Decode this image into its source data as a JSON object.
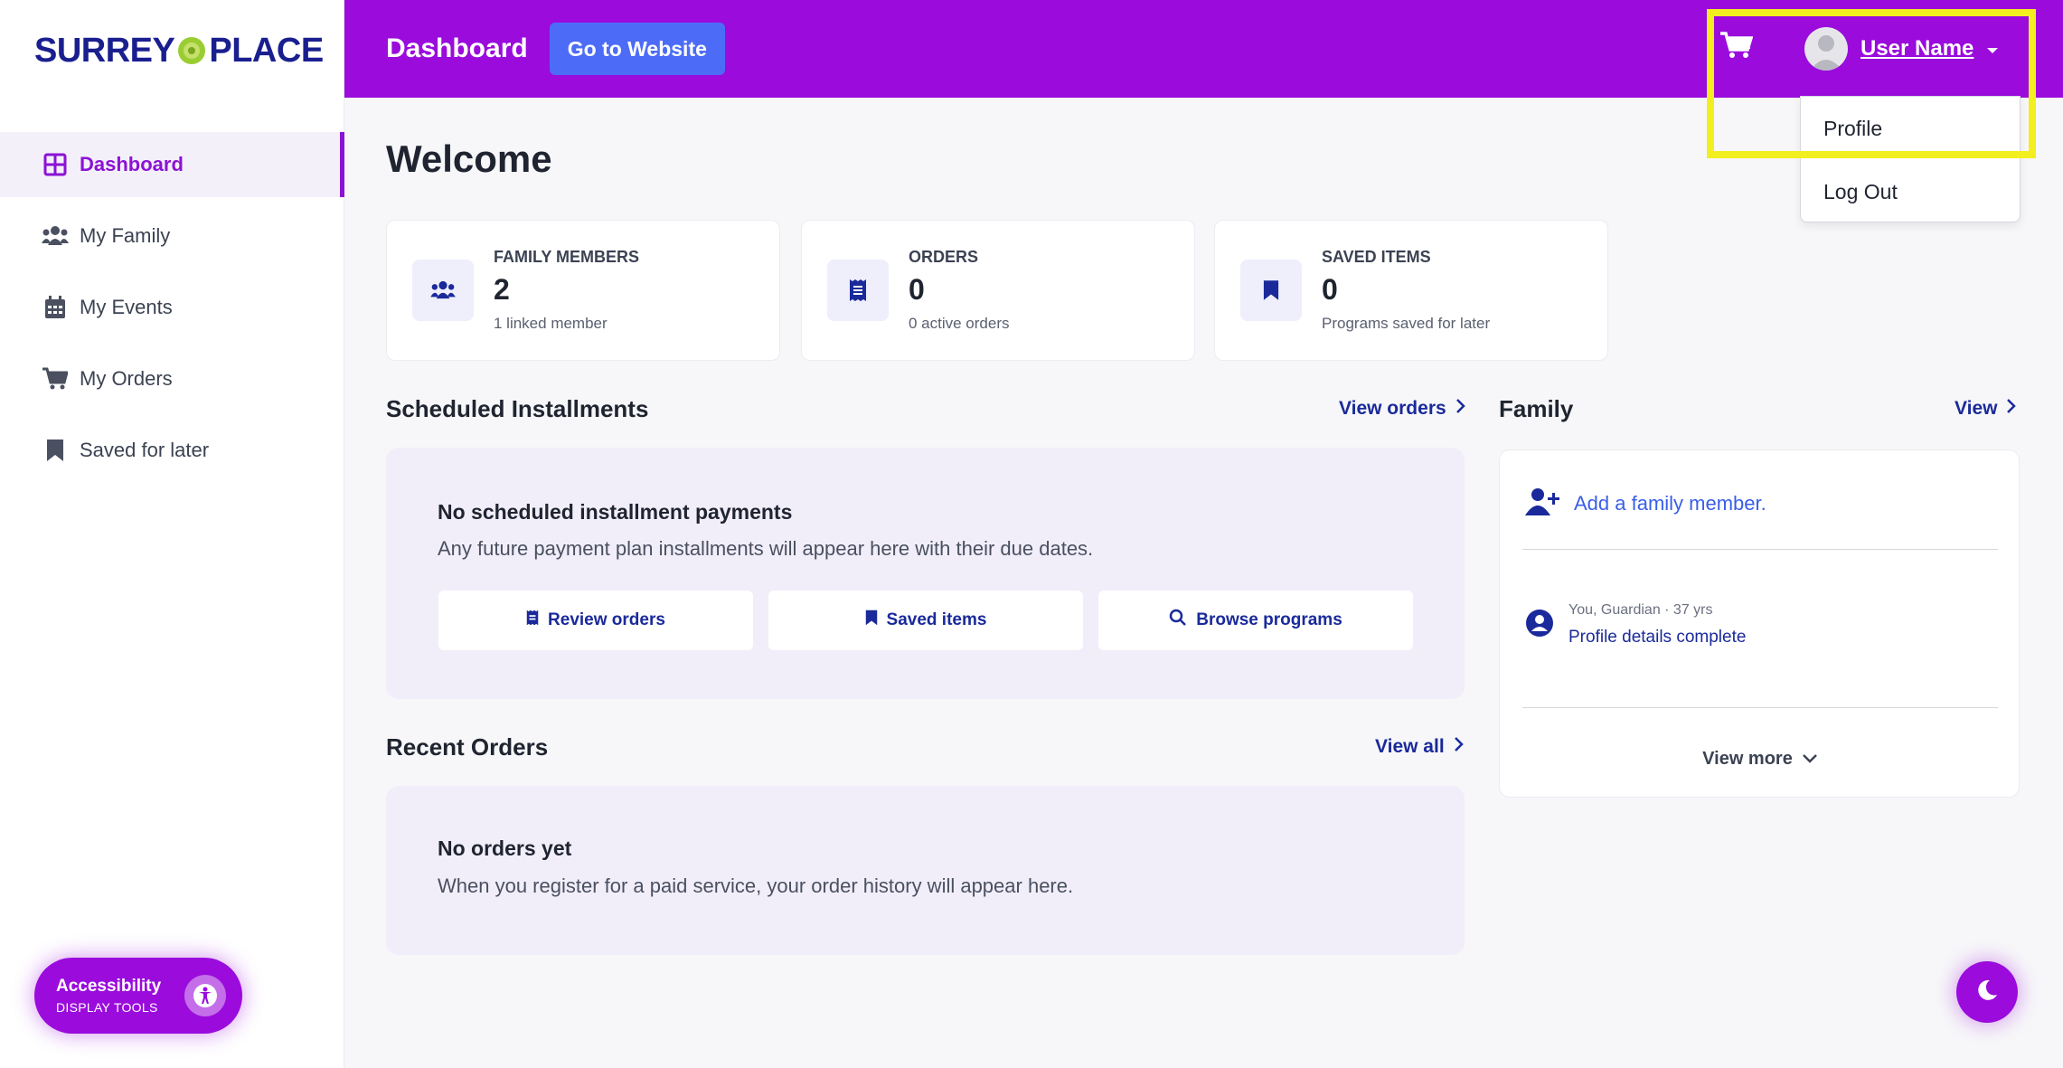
{
  "brand": {
    "logo_left": "SURREY",
    "logo_right": "PLACE",
    "primary_color": "#9a0bdc",
    "accent_color": "#4c6cf7",
    "navy_color": "#1a1f8f"
  },
  "sidebar": {
    "items": [
      {
        "label": "Dashboard",
        "icon": "grid-icon",
        "active": true
      },
      {
        "label": "My Family",
        "icon": "people-icon",
        "active": false
      },
      {
        "label": "My Events",
        "icon": "calendar-icon",
        "active": false
      },
      {
        "label": "My Orders",
        "icon": "cart-icon",
        "active": false
      },
      {
        "label": "Saved for later",
        "icon": "bookmark-icon",
        "active": false
      }
    ]
  },
  "header": {
    "title": "Dashboard",
    "website_button": "Go to Website",
    "cart_icon": "cart-icon",
    "user_name": "User Name",
    "user_menu": {
      "items": [
        "Profile",
        "Log Out"
      ]
    }
  },
  "main": {
    "welcome": "Welcome",
    "stats": [
      {
        "label": "FAMILY MEMBERS",
        "value": "2",
        "sub": "1 linked member",
        "icon": "people-icon"
      },
      {
        "label": "ORDERS",
        "value": "0",
        "sub": "0 active orders",
        "icon": "receipt-icon"
      },
      {
        "label": "SAVED ITEMS",
        "value": "0",
        "sub": "Programs saved for later",
        "icon": "bookmark-icon"
      }
    ],
    "installments": {
      "title": "Scheduled Installments",
      "link": "View orders",
      "empty_title": "No scheduled installment payments",
      "empty_desc": "Any future payment plan installments will appear here with their due dates.",
      "buttons": [
        "Review orders",
        "Saved items",
        "Browse programs"
      ]
    },
    "recent_orders": {
      "title": "Recent Orders",
      "link": "View all",
      "empty_title": "No orders yet",
      "empty_desc": "When you register for a paid service, your order history will appear here."
    },
    "family": {
      "title": "Family",
      "link": "View",
      "add_label": "Add a family member.",
      "member_meta": "You, Guardian · 37 yrs",
      "member_status": "Profile details complete",
      "view_more": "View more"
    }
  },
  "a11y": {
    "title": "Accessibility",
    "subtitle": "DISPLAY TOOLS"
  }
}
